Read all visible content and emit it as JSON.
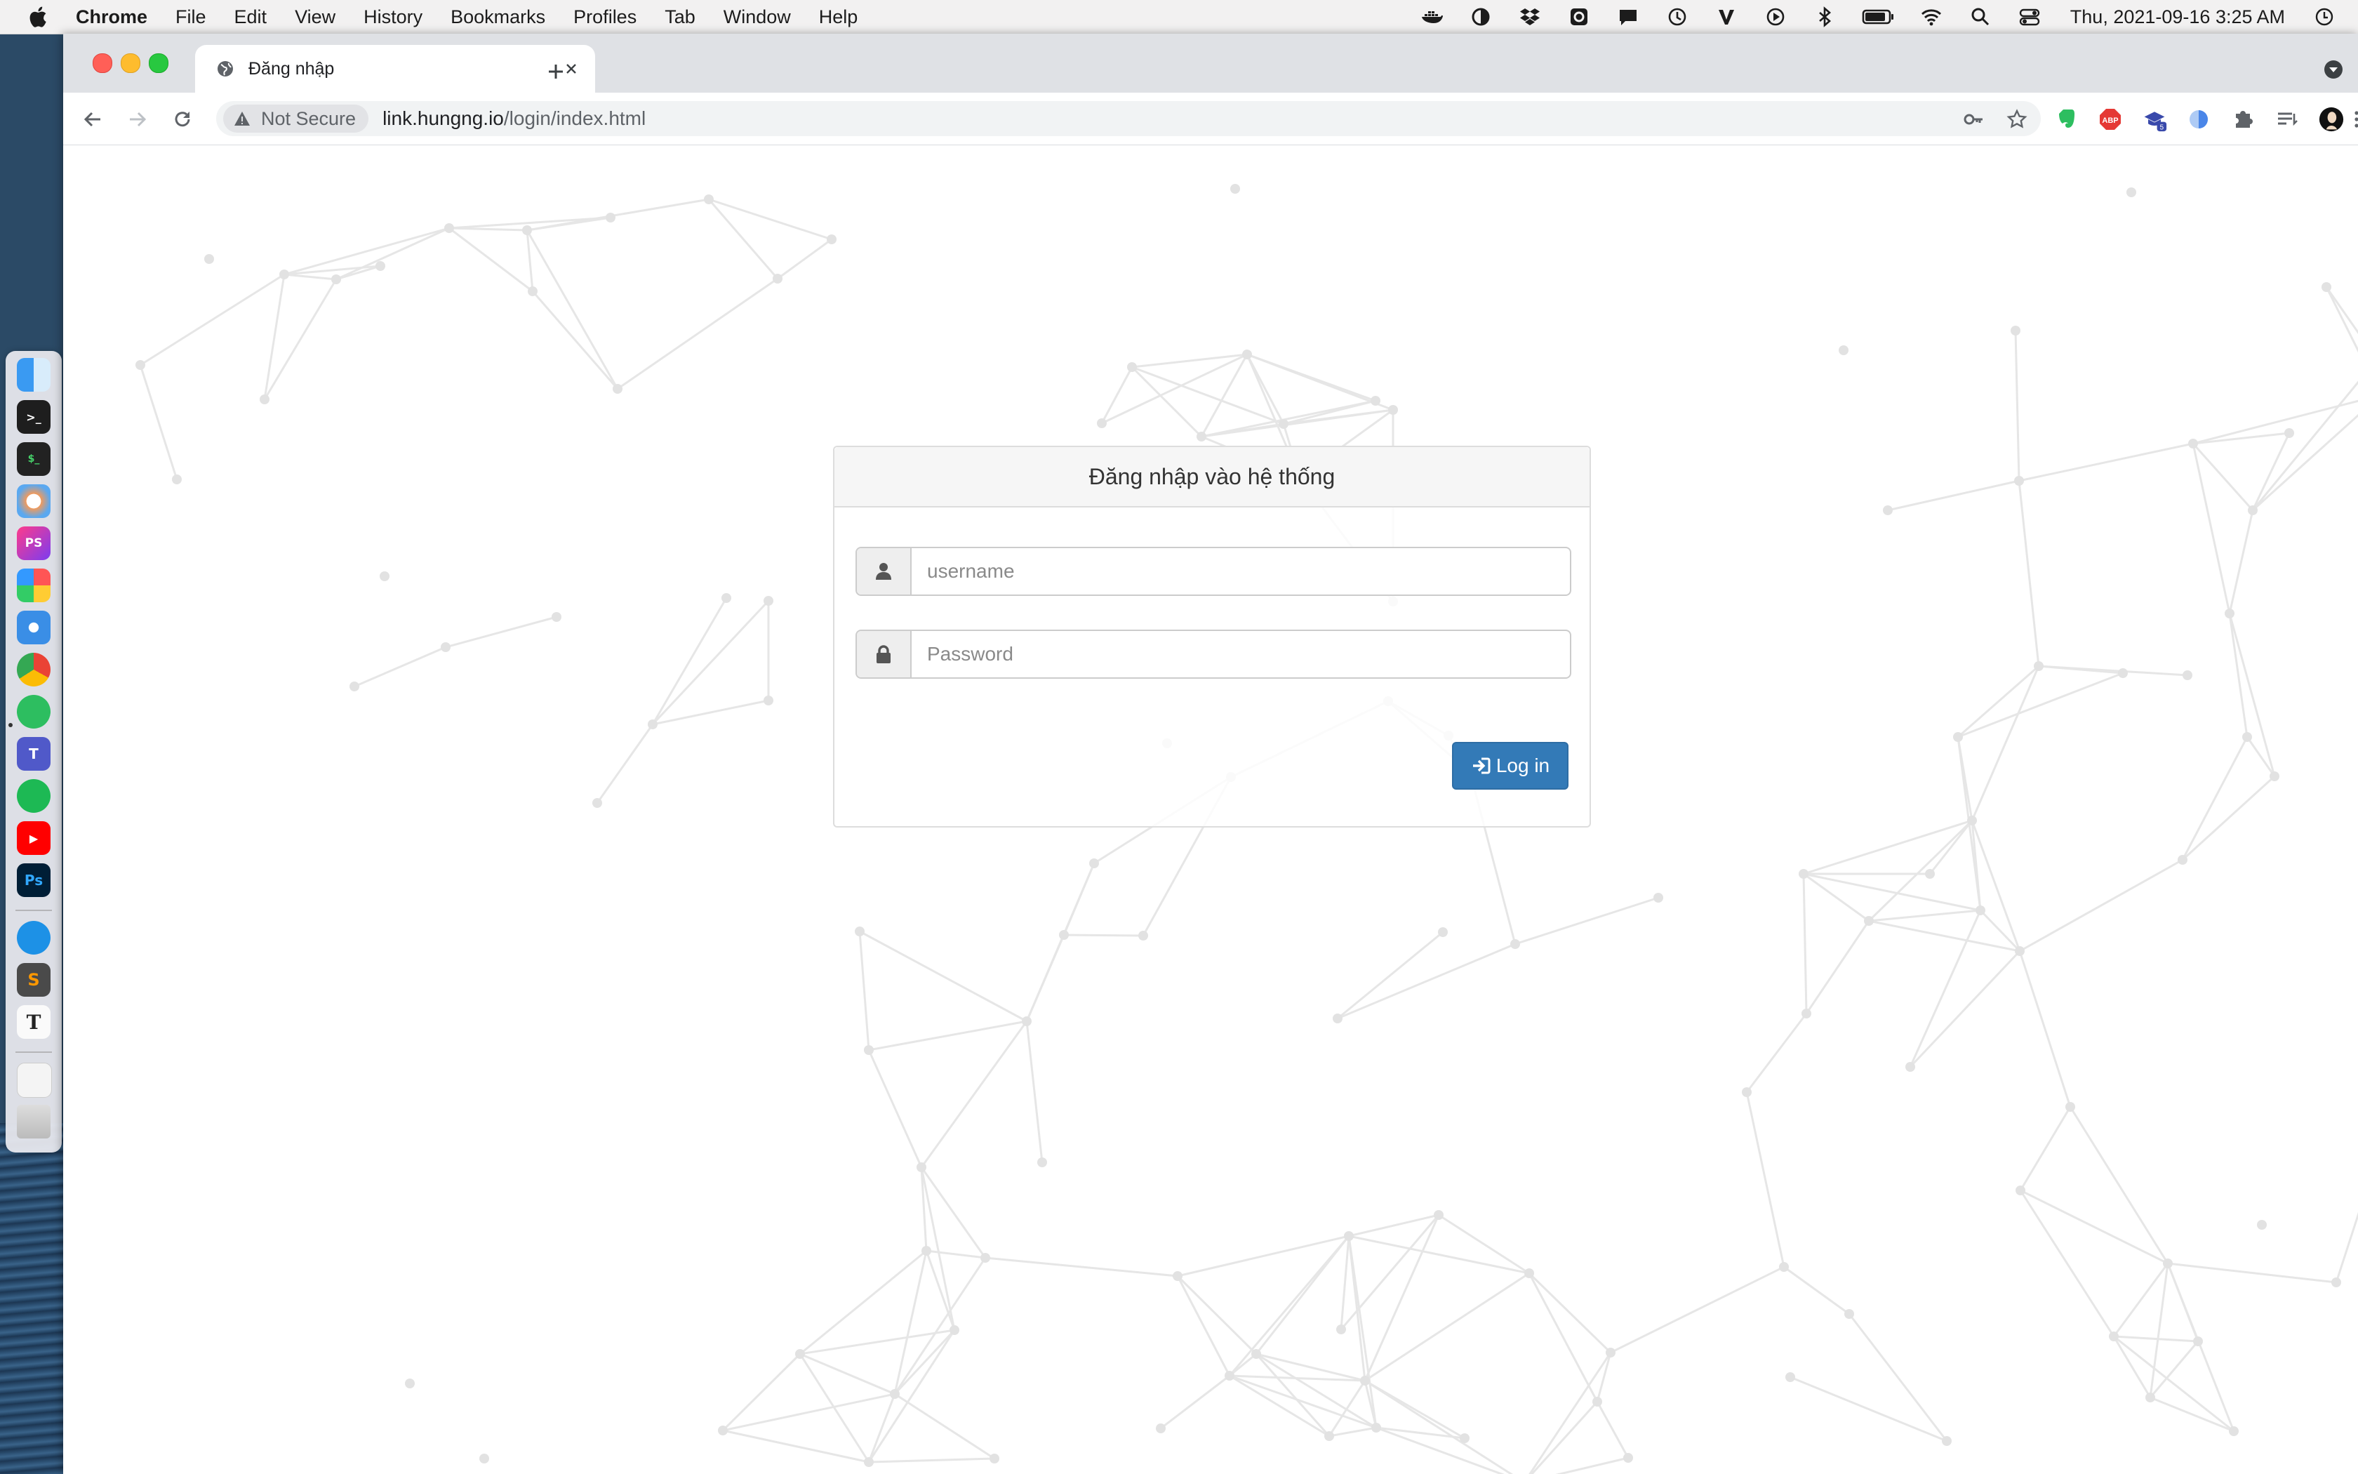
{
  "menubar": {
    "app_name": "Chrome",
    "items": [
      "File",
      "Edit",
      "View",
      "History",
      "Bookmarks",
      "Profiles",
      "Tab",
      "Window",
      "Help"
    ],
    "clock": "Thu, 2021-09-16 3:25 AM",
    "status_icons": [
      "docker-icon",
      "contrast-icon",
      "dropbox-icon",
      "settings-cog-icon",
      "notification-icon",
      "time-machine-icon",
      "v-icon",
      "play-icon",
      "bluetooth-icon",
      "battery-icon",
      "wifi-icon",
      "search-icon",
      "control-center-icon",
      "clock-icon"
    ]
  },
  "dock": {
    "apps": [
      "finder",
      "terminal",
      "iterm",
      "arc",
      "phpstorm",
      "launchpad",
      "safari",
      "chrome",
      "evernote",
      "teams",
      "spotify",
      "youtube",
      "photoshop",
      "docker",
      "sublime-text",
      "typora",
      "document",
      "trash"
    ]
  },
  "browser": {
    "tab_title": "Đăng nhập",
    "security_label": "Not Secure",
    "url_host": "link.hungng.io",
    "url_path": "/login/index.html",
    "extension_badge": "5"
  },
  "login": {
    "heading": "Đăng nhập vào hệ thống",
    "username_placeholder": "username",
    "password_placeholder": "Password",
    "submit_label": "Log in"
  },
  "colors": {
    "primary": "#337ab7",
    "network_lines": "#e6e6e6"
  }
}
